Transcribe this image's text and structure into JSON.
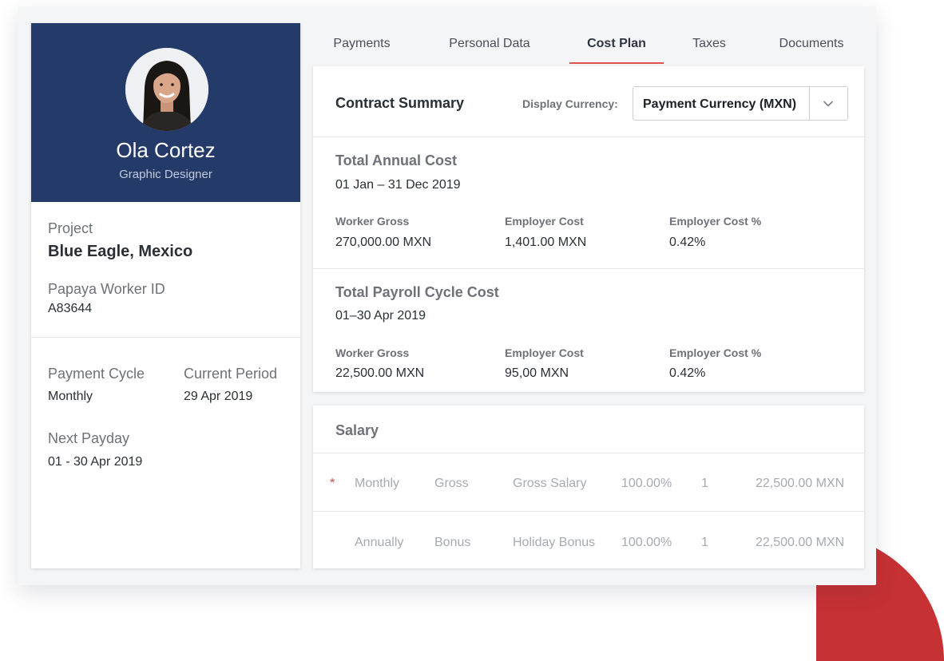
{
  "profile": {
    "name": "Ola Cortez",
    "role": "Graphic Designer",
    "project_label": "Project",
    "project_value": "Blue Eagle, Mexico",
    "worker_id_label": "Papaya Worker ID",
    "worker_id_value": "A83644",
    "payment_cycle_label": "Payment Cycle",
    "payment_cycle_value": "Monthly",
    "current_period_label": "Current Period",
    "current_period_value": "29 Apr 2019",
    "next_payday_label": "Next Payday",
    "next_payday_value": "01 - 30 Apr 2019"
  },
  "tabs": [
    {
      "label": "Payments"
    },
    {
      "label": "Personal Data"
    },
    {
      "label": "Cost Plan"
    },
    {
      "label": "Taxes"
    },
    {
      "label": "Documents"
    }
  ],
  "active_tab": "Cost Plan",
  "summary": {
    "title": "Contract Summary",
    "display_currency_label": "Display Currency:",
    "display_currency_value": "Payment Currency (MXN)"
  },
  "annual": {
    "title": "Total Annual Cost",
    "period": "01 Jan – 31 Dec 2019",
    "worker_gross_label": "Worker Gross",
    "worker_gross_value": "270,000.00 MXN",
    "employer_cost_label": "Employer Cost",
    "employer_cost_value": "1,401.00 MXN",
    "employer_pct_label": "Employer Cost %",
    "employer_pct_value": "0.42%"
  },
  "payroll": {
    "title": "Total Payroll Cycle Cost",
    "period": "01–30 Apr 2019",
    "worker_gross_label": "Worker Gross",
    "worker_gross_value": "22,500.00 MXN",
    "employer_cost_label": "Employer Cost",
    "employer_cost_value": "95,00 MXN",
    "employer_pct_label": "Employer Cost %",
    "employer_pct_value": "0.42%"
  },
  "salary": {
    "title": "Salary",
    "rows": [
      {
        "required": "*",
        "frequency": "Monthly",
        "type": "Gross",
        "name": "Gross Salary",
        "percent": "100.00%",
        "qty": "1",
        "amount": "22,500.00 MXN"
      },
      {
        "required": "",
        "frequency": "Annually",
        "type": "Bonus",
        "name": "Holiday Bonus",
        "percent": "100.00%",
        "qty": "1",
        "amount": "22,500.00 MXN"
      }
    ]
  },
  "colors": {
    "header_navy": "#243a69",
    "accent_red": "#c63133",
    "tab_underline": "#e2534f"
  },
  "icons": {
    "select_toggle": "chevron-down-icon",
    "corner_decoration": "quarter-circle-decoration"
  }
}
